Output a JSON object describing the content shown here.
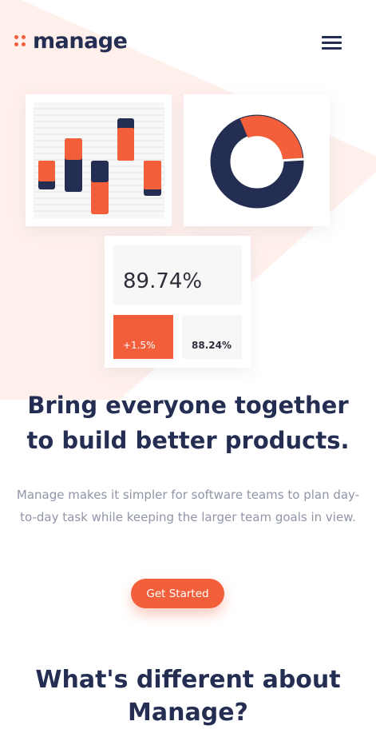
{
  "brand": {
    "name": "manage",
    "accent": "#f25f3a",
    "navy": "#242d52",
    "tint": "#fff0ec"
  },
  "nav": {
    "menu_icon": "hamburger-icon"
  },
  "hero": {
    "title_line1": "Bring everyone together",
    "title_line2": "to build better products.",
    "description": "Manage makes it simpler for software teams to plan day-to-day task while keeping the larger team goals in view.",
    "cta_label": "Get Started"
  },
  "illustration": {
    "stat_main": "89.74%",
    "stat_up": "+1.5%",
    "stat_down": "88.24%"
  },
  "section": {
    "title_line1": "What's different about",
    "title_line2": "Manage?"
  }
}
